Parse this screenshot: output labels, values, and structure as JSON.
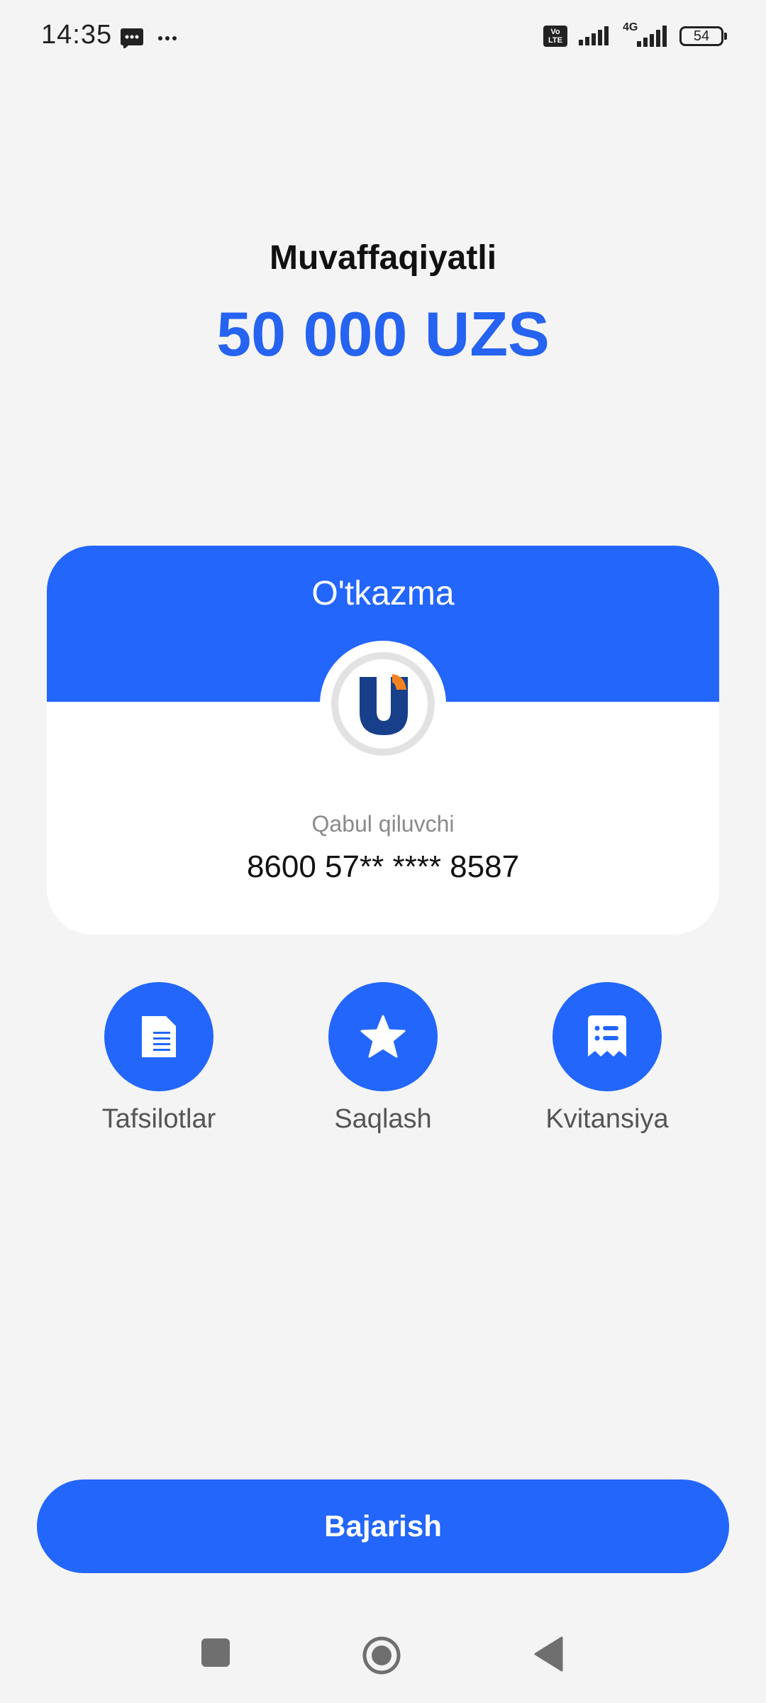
{
  "status_bar": {
    "time": "14:35",
    "battery": "54",
    "network": "4G",
    "volte": "Vo LTE",
    "icons": [
      "message-icon",
      "more-icon",
      "volte-icon",
      "signal-icon",
      "signal-4g-icon",
      "battery-icon"
    ]
  },
  "header": {
    "title": "Muvaffaqiyatli",
    "amount": "50 000 UZS"
  },
  "card": {
    "title": "O'tkazma",
    "logo": "uzcard-logo",
    "recipient_label": "Qabul qiluvchi",
    "recipient_value": "8600 57** **** 8587"
  },
  "actions": [
    {
      "label": "Tafsilotlar",
      "icon": "document-icon"
    },
    {
      "label": "Saqlash",
      "icon": "star-icon"
    },
    {
      "label": "Kvitansiya",
      "icon": "receipt-icon"
    }
  ],
  "primary_button": {
    "label": "Bajarish"
  },
  "nav_bar": {
    "icons": [
      "recents-icon",
      "home-icon",
      "back-icon"
    ]
  },
  "colors": {
    "accent": "#2366fb",
    "background": "#f4f4f4",
    "text": "#111111",
    "muted": "#8a8a8a"
  }
}
